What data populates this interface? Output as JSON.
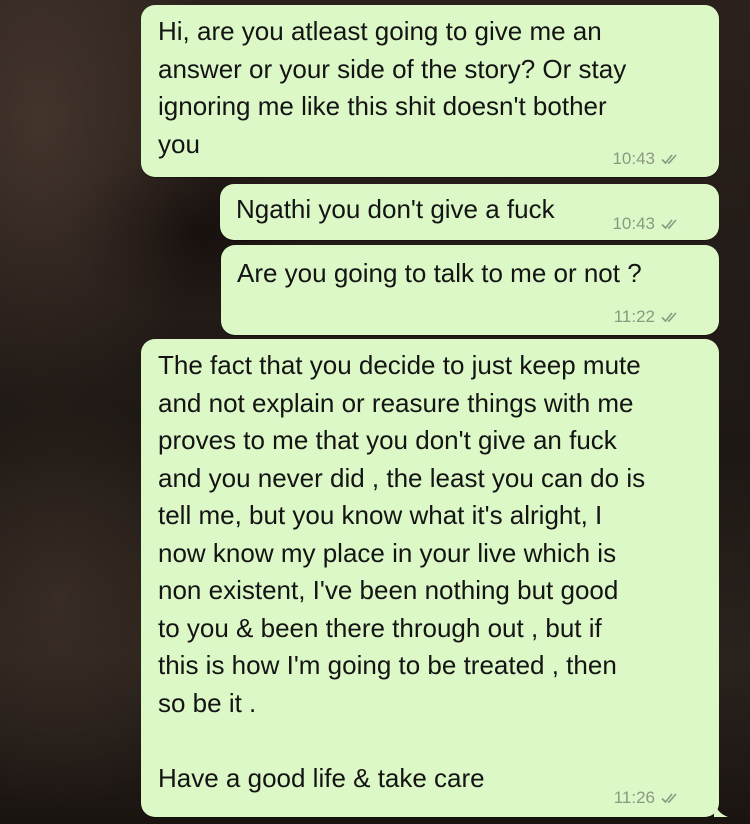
{
  "messages": [
    {
      "text": "Hi, are you atleast going to give me an\nanswer or your side of the story? Or stay\nignoring me like this shit doesn't bother\nyou",
      "time": "10:43",
      "status_icon": "double-check-icon"
    },
    {
      "text": "Ngathi you don't give a fuck",
      "time": "10:43",
      "status_icon": "double-check-icon"
    },
    {
      "text": "Are you going to talk to me or not ?",
      "time": "11:22",
      "status_icon": "double-check-icon"
    },
    {
      "text": "The fact that you decide to just keep mute\nand not explain or reasure things with me\nproves to me that you don't give an fuck\nand you never did , the least you can do is\ntell me, but you know what it's alright, I\nnow know my place in your live which is\nnon existent, I've been nothing but good\nto you & been there through out , but if\nthis is how I'm going to be treated , then\nso be it .\n\nHave a good life & take care",
      "time": "11:26",
      "status_icon": "double-check-icon"
    }
  ],
  "colors": {
    "outgoing_bubble": "#dcf8c6",
    "meta_text": "#8a9a82"
  }
}
